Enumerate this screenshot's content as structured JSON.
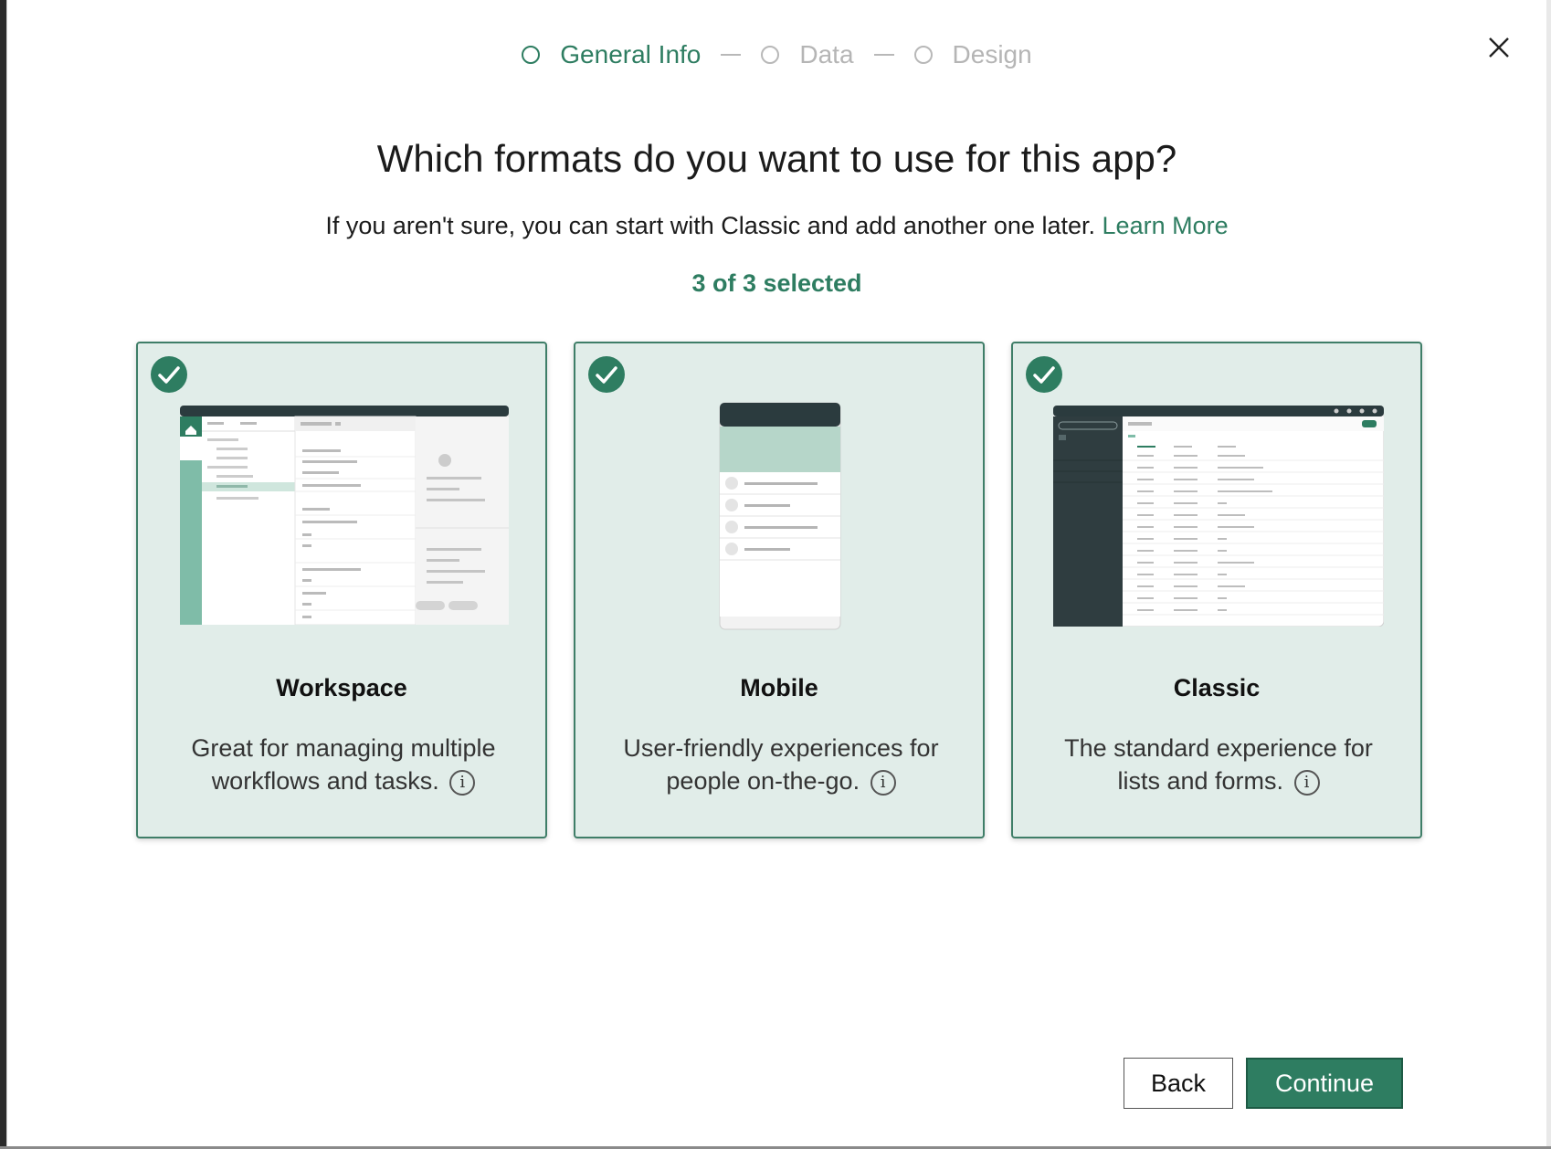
{
  "stepper": {
    "steps": [
      {
        "label": "General Info",
        "state": "active"
      },
      {
        "label": "Data",
        "state": "inactive"
      },
      {
        "label": "Design",
        "state": "inactive"
      }
    ]
  },
  "dialog": {
    "title": "Which formats do you want to use for this app?",
    "subtitle": "If you aren't sure, you can start with Classic and add another one later.",
    "learn_more": "Learn More",
    "selected_count": "3 of 3 selected"
  },
  "cards": [
    {
      "name": "Workspace",
      "description": "Great for managing multiple workflows and tasks.",
      "selected": true
    },
    {
      "name": "Mobile",
      "description": "User-friendly experiences for people on-the-go.",
      "selected": true
    },
    {
      "name": "Classic",
      "description": "The standard experience for lists and forms.",
      "selected": true
    }
  ],
  "actions": {
    "back_label": "Back",
    "continue_label": "Continue"
  },
  "icons": {
    "close": "close-icon",
    "check": "checkmark-icon",
    "info": "info-icon"
  },
  "colors": {
    "accent": "#2e7d61",
    "card_bg": "#e1ede9"
  }
}
